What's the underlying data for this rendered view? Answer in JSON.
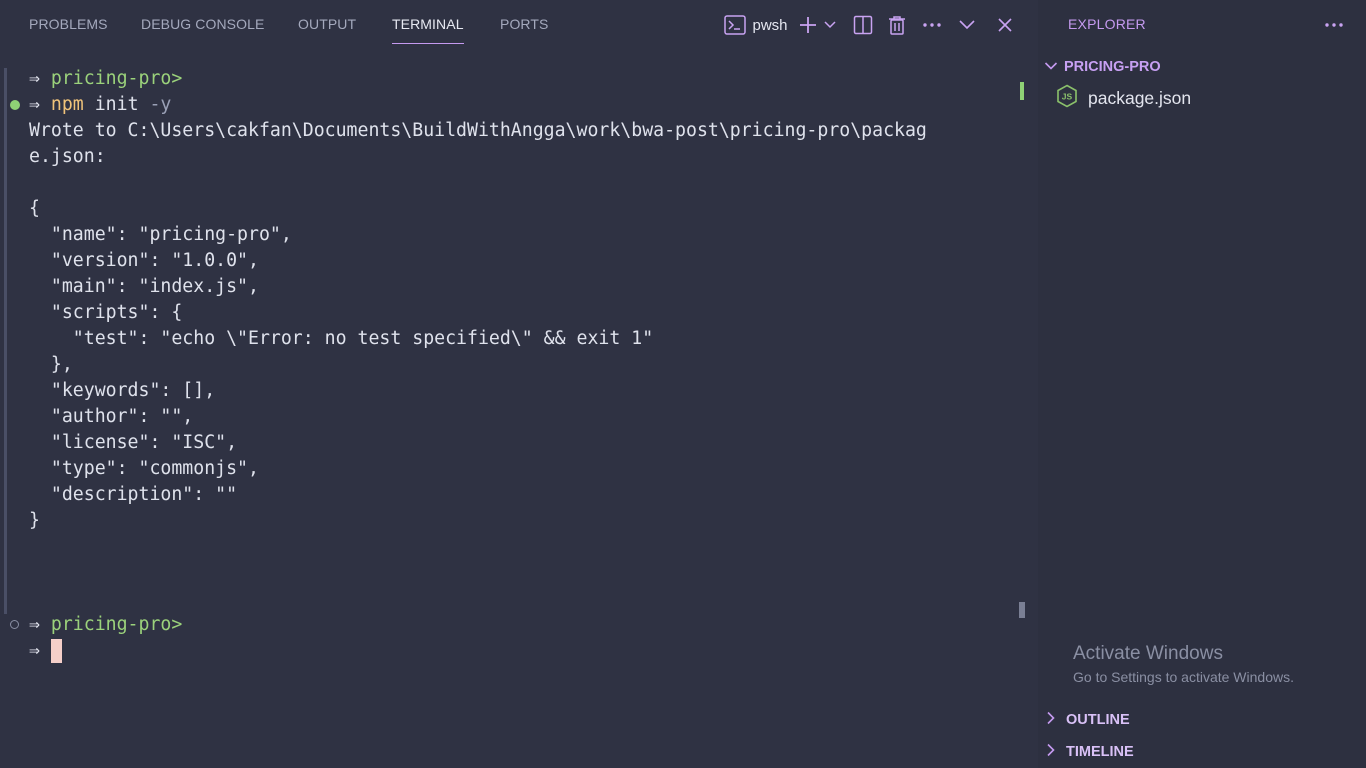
{
  "panel": {
    "tabs": [
      {
        "label": "PROBLEMS"
      },
      {
        "label": "DEBUG CONSOLE"
      },
      {
        "label": "OUTPUT"
      },
      {
        "label": "TERMINAL"
      },
      {
        "label": "PORTS"
      }
    ],
    "active_tab": "TERMINAL",
    "shell_name": "pwsh"
  },
  "terminal": {
    "prompt_arrow": "⇒",
    "prompt_path": "pricing-pro>",
    "command": "npm",
    "command_args": " init ",
    "command_flag": "-y",
    "output_lines": [
      "Wrote to C:\\Users\\cakfan\\Documents\\BuildWithAngga\\work\\bwa-post\\pricing-pro\\packag",
      "e.json:",
      "",
      "{",
      "  \"name\": \"pricing-pro\",",
      "  \"version\": \"1.0.0\",",
      "  \"main\": \"index.js\",",
      "  \"scripts\": {",
      "    \"test\": \"echo \\\"Error: no test specified\\\" && exit 1\"",
      "  },",
      "  \"keywords\": [],",
      "  \"author\": \"\",",
      "  \"license\": \"ISC\",",
      "  \"type\": \"commonjs\",",
      "  \"description\": \"\"",
      "}"
    ]
  },
  "explorer": {
    "title": "EXPLORER",
    "folder": "PRICING-PRO",
    "files": [
      {
        "name": "package.json",
        "icon": "nodejs-icon"
      }
    ],
    "sections": [
      {
        "label": "OUTLINE"
      },
      {
        "label": "TIMELINE"
      }
    ]
  },
  "watermark": {
    "title": "Activate Windows",
    "subtitle": "Go to Settings to activate Windows."
  },
  "colors": {
    "background": "#2f3243",
    "accent": "#c59af0",
    "prompt_path": "#9bd27b",
    "command": "#f0c37a",
    "success_dot": "#8fd175",
    "cursor": "#f5cfc9"
  }
}
